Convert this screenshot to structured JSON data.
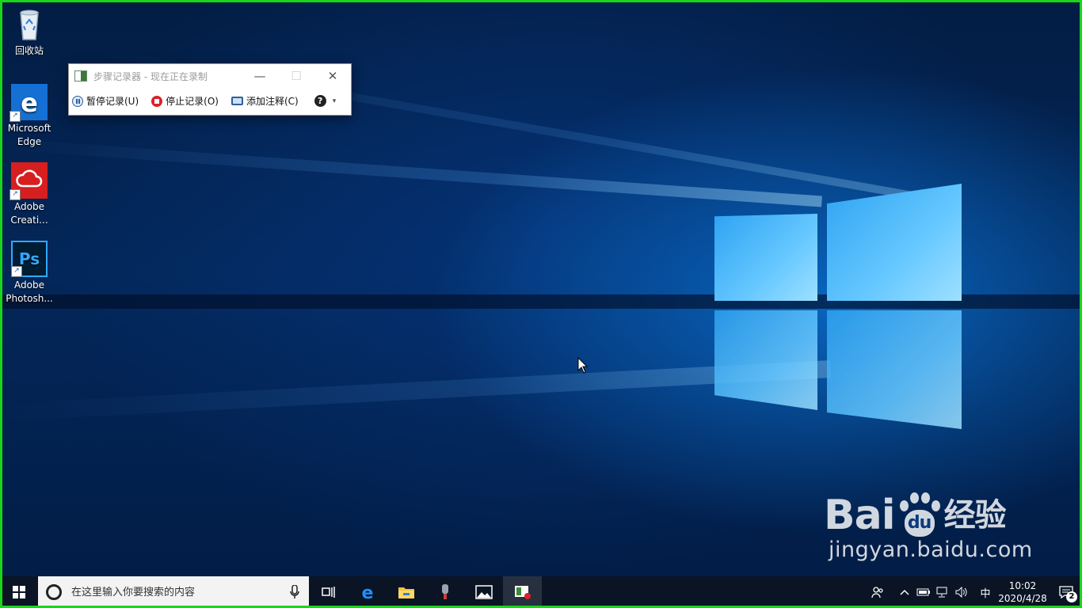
{
  "desktop": {
    "icons": [
      {
        "label": "回收站",
        "icon": "recycle-bin-icon"
      },
      {
        "label": "Microsoft Edge",
        "icon": "edge-icon"
      },
      {
        "label": "Adobe Creati...",
        "icon": "adobe-creative-cloud-icon"
      },
      {
        "label": "Adobe Photosh...",
        "icon": "photoshop-icon"
      }
    ],
    "photoshop_glyph": "Ps"
  },
  "steps_recorder": {
    "title": "步骤记录器 - 现在正在录制",
    "minimize": "—",
    "maximize": "☐",
    "close": "✕",
    "pause_label": "暂停记录(U)",
    "stop_label": "停止记录(O)",
    "add_comment_label": "添加注释(C)",
    "help_glyph": "?",
    "menu_caret": "▾"
  },
  "watermark": {
    "logo_text_left": "Bai",
    "logo_text_right": "经验",
    "paw_text": "du",
    "url": "jingyan.baidu.com"
  },
  "taskbar": {
    "search_placeholder": "在这里输入你要搜索的内容",
    "apps": [
      "task-view",
      "edge",
      "file-explorer",
      "voice-recorder",
      "photos",
      "steps-recorder"
    ],
    "tray": {
      "ime": "中",
      "time": "10:02",
      "date": "2020/4/28",
      "notification_count": "2"
    }
  },
  "colors": {
    "frame": "#18d618",
    "taskbar": "#0a1422",
    "accent": "#76b9ed",
    "stop_red": "#d9222a"
  }
}
